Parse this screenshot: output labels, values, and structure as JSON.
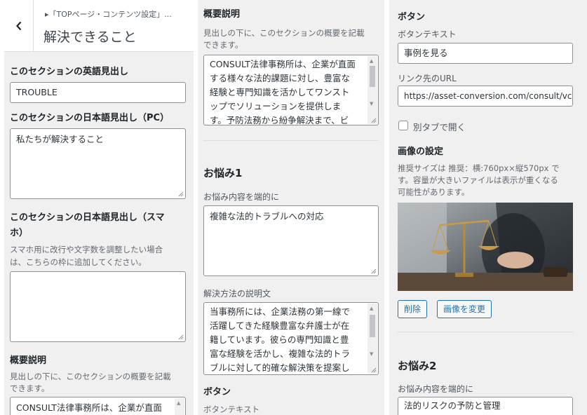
{
  "panel1": {
    "breadcrumb": "▸「TOPページ・コンテンツ設定」...",
    "title": "解決できること",
    "en_heading_label": "このセクションの英語見出し",
    "en_heading_value": "TROUBLE",
    "jp_heading_pc_label": "このセクションの日本語見出し（PC）",
    "jp_heading_pc_value": "私たちが解決すること",
    "jp_heading_sp_label_line1": "このセクションの日本語見出し（スマ",
    "jp_heading_sp_label_line2": "ホ）",
    "jp_heading_sp_desc_line1": "スマホ用に改行や文字数を調整したい場合",
    "jp_heading_sp_desc_line2": "は、こちらの枠に追加してください。",
    "jp_heading_sp_value": "",
    "overview_label": "概要説明",
    "overview_desc_line1": "見出しの下に、このセクションの概要を記載",
    "overview_desc_line2": "できます。",
    "overview_value": "CONSULT法律事務所は、企業が直面"
  },
  "panel2": {
    "overview_label": "概要説明",
    "overview_desc_line1": "見出しの下に、このセクションの概要を記載",
    "overview_desc_line2": "できます。",
    "overview_lines": [
      "CONSULT法律事務所は、企業が直面",
      "する様々な法的課題に対し、豊富な",
      "経験と専門知識を活かしてワンスト",
      "ップでソリューションを提供しま",
      "す。予防法務から紛争解決まで、ビ"
    ],
    "worry1_title": "お悩み1",
    "worry_content_label": "お悩み内容を端的に",
    "worry_content_value": "複雑な法的トラブルへの対応",
    "solution_label": "解決方法の説明文",
    "solution_lines": [
      "当事務所には、企業法務の第一線で",
      "活躍してきた経験豊富な弁護士が在",
      "籍しています。彼らの専門知識と豊",
      "富な経験を活かし、複雑な法的トラ",
      "ブルに対して的確な解決策を提案し"
    ],
    "button_heading": "ボタン",
    "button_text_label": "ボタンテキスト"
  },
  "panel3": {
    "button_heading": "ボタン",
    "button_text_label": "ボタンテキスト",
    "button_text_value": "事例を見る",
    "link_label": "リンク先のURL",
    "link_value": "https://asset-conversion.com/consult/vc",
    "new_tab_label": "別タブで開く",
    "new_tab_checked": false,
    "image_label": "画像の設定",
    "image_desc_line1": "推奨サイズは 推奨：横:760px×縦570px で",
    "image_desc_line2": "す。容量が大きいファイルは表示が重くなる",
    "image_desc_line3": "可能性があります。",
    "delete_label": "削除",
    "change_image_label": "画像を変更",
    "worry2_title": "お悩み2",
    "worry_content_label": "お悩み内容を端的に",
    "worry_content_value": "法的リスクの予防と管理"
  },
  "icons": {
    "back": "chevron-left-icon",
    "resize": "resize-grip-icon",
    "image": "scales-of-justice-image"
  }
}
